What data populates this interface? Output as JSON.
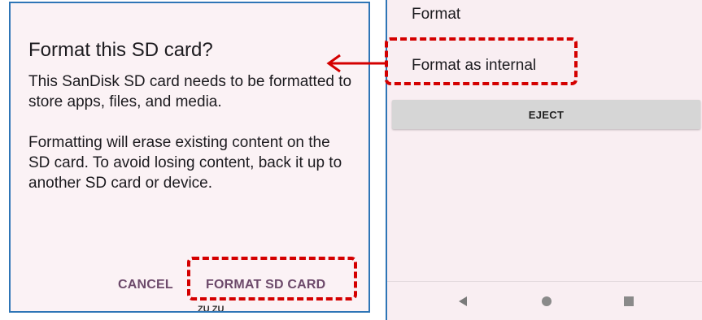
{
  "dialog": {
    "title": "Format this SD card?",
    "body_1": "This SanDisk SD card needs to be formatted to store apps, files, and media.",
    "body_2": "Formatting will erase existing content on the SD card. To avoid losing content, back it up to another SD card or device.",
    "cancel_label": "CANCEL",
    "format_label": "FORMAT SD CARD",
    "peek_text": "ZU ZU"
  },
  "storage_menu": {
    "items": [
      {
        "label": "Format"
      },
      {
        "label": "Format as internal"
      }
    ],
    "eject_label": "EJECT"
  },
  "navbar": {
    "icons": [
      "back-icon",
      "home-icon",
      "recents-icon"
    ]
  },
  "colors": {
    "highlight": "#d40000",
    "frame_border": "#2e75b6",
    "dialog_button": "#6d4a6b",
    "panel_background": "#f9eef2"
  }
}
